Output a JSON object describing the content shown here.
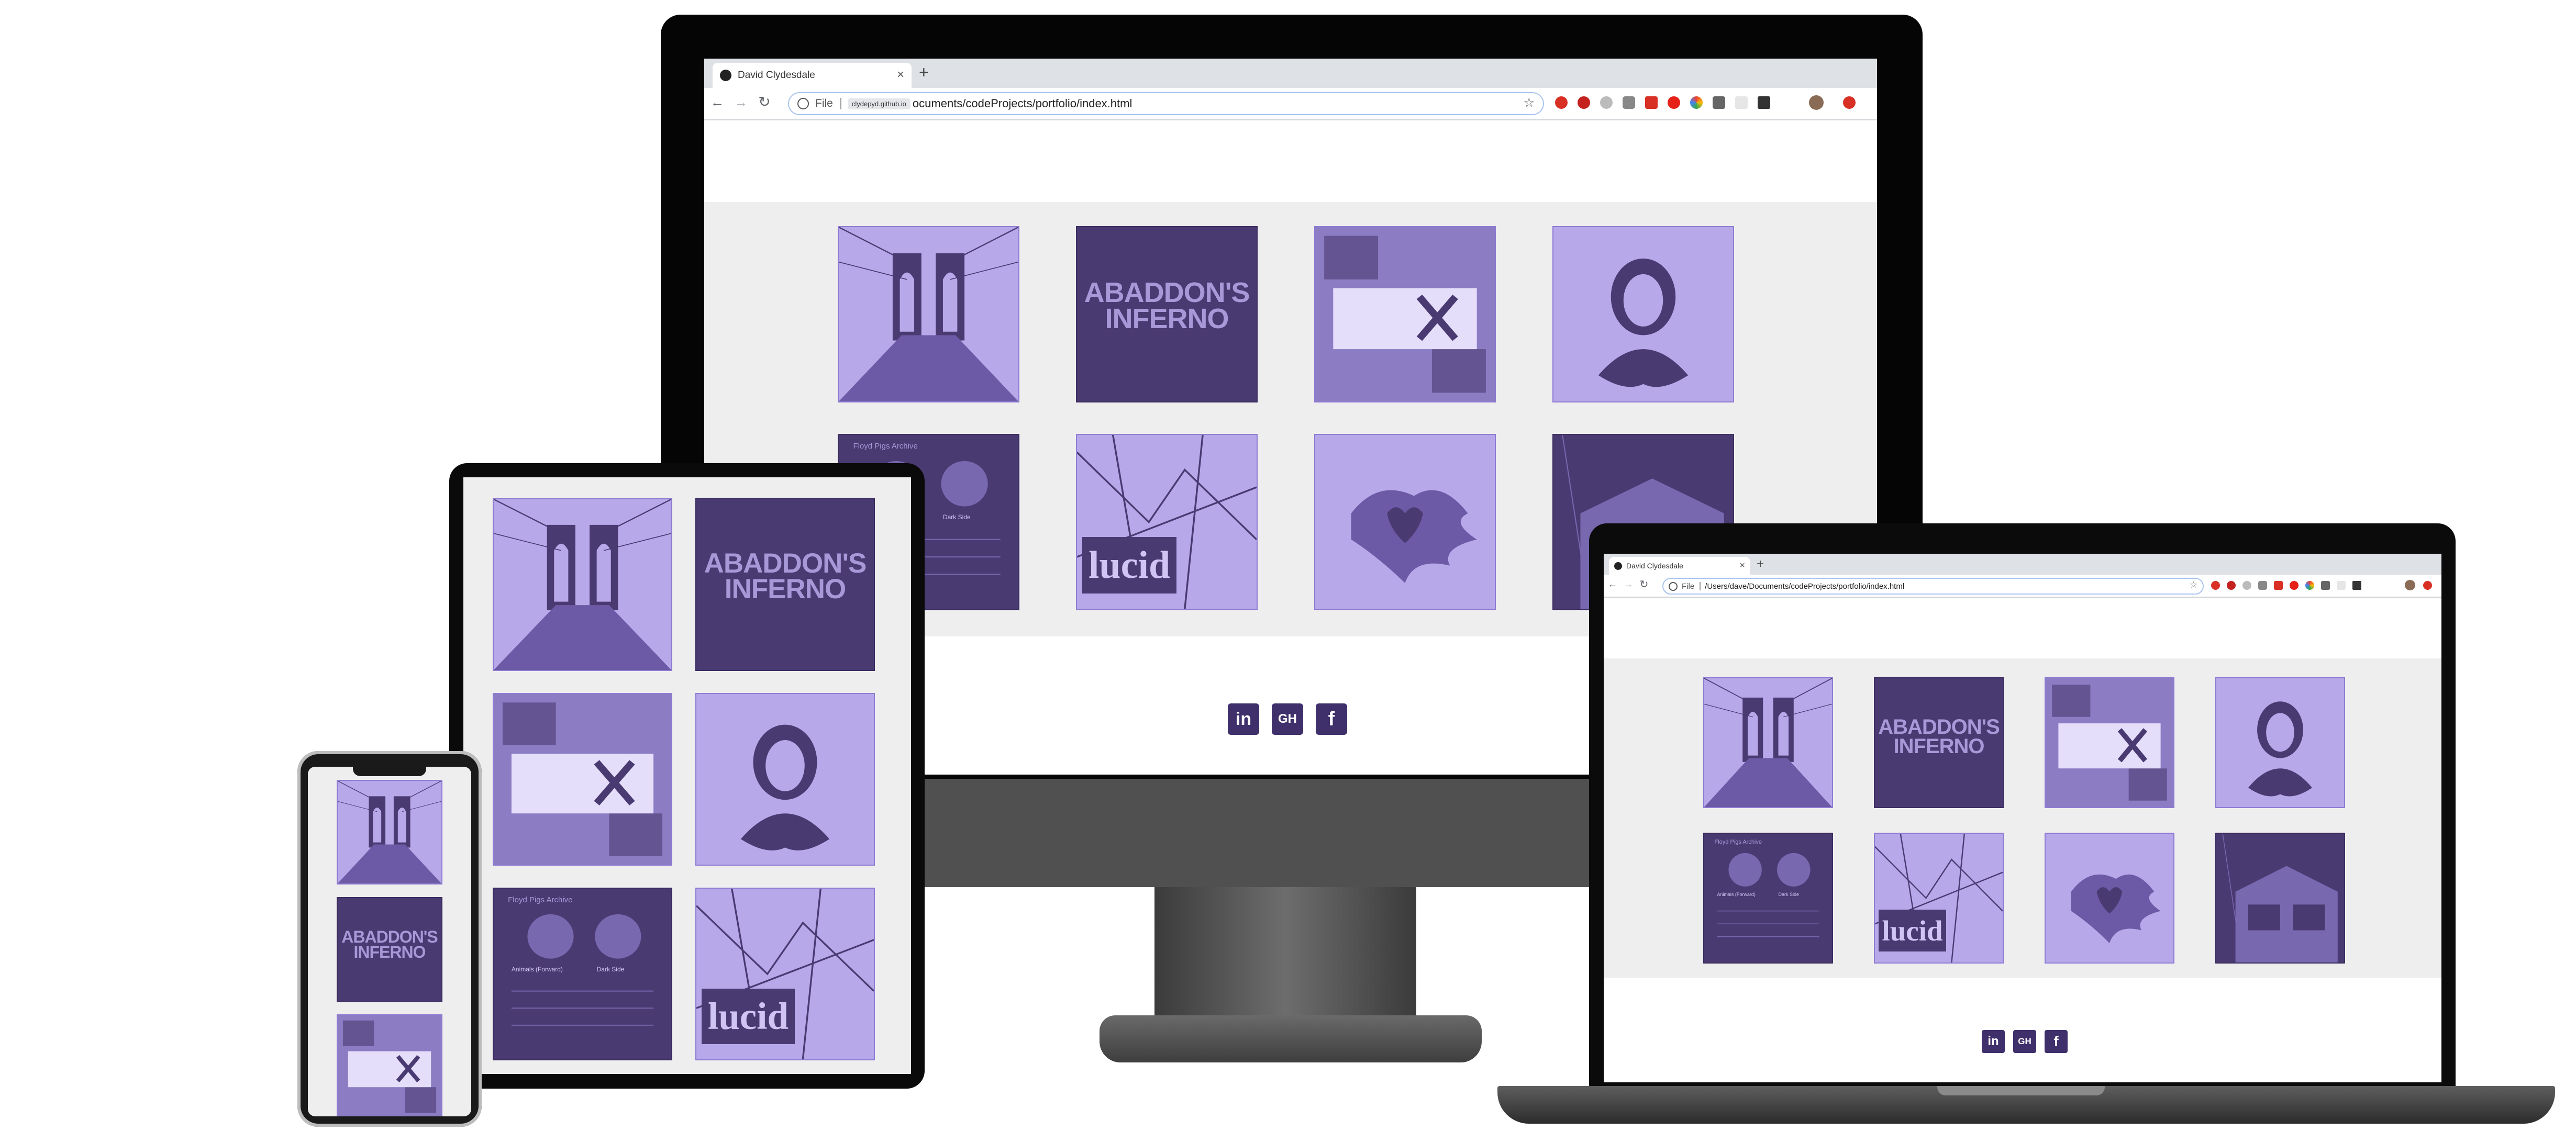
{
  "browser": {
    "tab_title": "David Clydesdale",
    "new_tab": "+",
    "close": "×",
    "back": "←",
    "forward": "→",
    "reload": "↻",
    "scheme": "File",
    "url_desktop_badge": "clydepyd.github.io",
    "url_desktop": "ocuments/codeProjects/portfolio/index.html",
    "url_laptop": "/Users/dave/Documents/codeProjects/portfolio/index.html",
    "star": "☆"
  },
  "tiles": [
    {
      "name": "bridge",
      "style": "light",
      "icon": "bridge-photo-icon"
    },
    {
      "name": "abaddons-inferno",
      "style": "dark",
      "text": "ABADDON'S INFERNO"
    },
    {
      "name": "recipe-app",
      "style": "light",
      "icon": "fork-knife-icon"
    },
    {
      "name": "shakespeare",
      "style": "light",
      "icon": "portrait-collage-icon"
    },
    {
      "name": "music-player",
      "style": "dark",
      "heading": "Floyd Pigs Archive",
      "cap_left": "Animals (Forward)",
      "cap_right": "Dark Side"
    },
    {
      "name": "lucid",
      "style": "light",
      "text": "lucid"
    },
    {
      "name": "heart-lion",
      "style": "light",
      "icon": "heart-lion-icon"
    },
    {
      "name": "house",
      "style": "dark",
      "icon": "house-photo-icon"
    }
  ],
  "social": {
    "linkedin": "in",
    "github": "GH",
    "facebook": "f"
  },
  "colors": {
    "accent_light": "#b7a8ea",
    "accent_dark": "#4a3a72",
    "band": "#efeeef"
  }
}
